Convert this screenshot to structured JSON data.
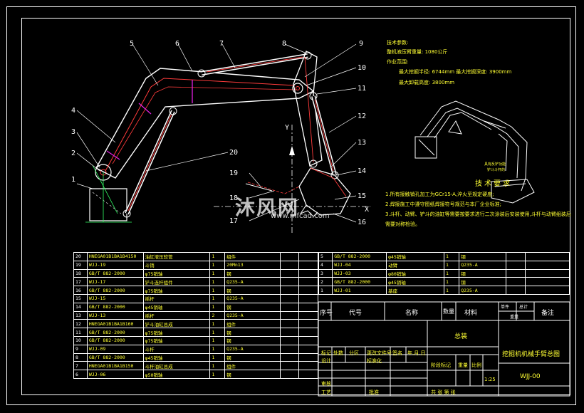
{
  "callouts": [
    "1",
    "2",
    "3",
    "4",
    "5",
    "6",
    "7",
    "8",
    "9",
    "10",
    "11",
    "12",
    "13",
    "14",
    "15",
    "16",
    "17",
    "18",
    "19",
    "20"
  ],
  "axis_label_y": "Y",
  "axis_label_x": "X",
  "tech_params": {
    "heading": "技术参数:",
    "line1": "整机液压臂重量: 1080公斤",
    "line2": "作业范围:",
    "line3": "最大挖掘半径: 6744mm    最大挖掘深度: 3900mm",
    "line4": "最大卸载高度: 3800mm"
  },
  "tech_req": {
    "title": "技术要求",
    "item1": "1.所有接触销孔加工为GCr15-A,淬火至规定硬度;",
    "item2": "2.焊接施工中遵守图纸焊接符号规范与本厂企业标准;",
    "item3": "3.斗杆、动臂、铲斗的油缸等需要按要求进行二次涂装后安装使用,斗杆与动臂组装后",
    "item4": "需要对称检验。"
  },
  "bom_left": [
    [
      "20",
      "HNEGA01B1BA1B4150",
      "油缸液压软管",
      "1",
      "组件",
      "",
      ""
    ],
    [
      "19",
      "WJJ-19",
      "斗销",
      "1",
      "20Mn13",
      "",
      ""
    ],
    [
      "18",
      "GB/T 882-2000",
      "φ75销轴",
      "1",
      "钢",
      "",
      ""
    ],
    [
      "17",
      "WJJ-17",
      "铲斗连杆组件",
      "1",
      "Q235-A",
      "",
      ""
    ],
    [
      "16",
      "GB/T 882-2000",
      "φ75销轴",
      "1",
      "钢",
      "",
      ""
    ],
    [
      "15",
      "WJJ-15",
      "摇杆",
      "1",
      "Q235-A",
      "",
      ""
    ],
    [
      "14",
      "GB/T 882-2000",
      "φ45销轴",
      "1",
      "钢",
      "",
      ""
    ],
    [
      "13",
      "WJJ-13",
      "摇杆",
      "2",
      "Q235-A",
      "",
      ""
    ],
    [
      "12",
      "HNEGA01B1BA1B160",
      "铲斗油缸总成",
      "1",
      "组件",
      "",
      ""
    ],
    [
      "11",
      "GB/T 882-2000",
      "φ75销轴",
      "1",
      "钢",
      "",
      ""
    ],
    [
      "10",
      "GB/T 882-2000",
      "φ75销轴",
      "1",
      "钢",
      "",
      ""
    ],
    [
      "9",
      "WJJ-09",
      "斗杆",
      "1",
      "Q235-A",
      "",
      ""
    ],
    [
      "8",
      "GB/T 882-2000",
      "φ45销轴",
      "1",
      "钢",
      "",
      ""
    ],
    [
      "7",
      "HNEGA01B1BA1B150",
      "斗杆油缸总成",
      "1",
      "组件",
      "",
      ""
    ],
    [
      "6",
      "WJJ-06",
      "φ50销轴",
      "1",
      "钢",
      "",
      ""
    ]
  ],
  "bom_right": [
    [
      "5",
      "GB/T 882-2000",
      "φ45销轴",
      "1",
      "钢",
      "",
      ""
    ],
    [
      "4",
      "WJJ-04",
      "动臂",
      "1",
      "Q235-A",
      "",
      ""
    ],
    [
      "3",
      "WJJ-03",
      "φ80销轴",
      "1",
      "钢",
      "",
      ""
    ],
    [
      "2",
      "GB/T 882-2000",
      "φ45销轴",
      "1",
      "钢",
      "",
      ""
    ],
    [
      "1",
      "WJJ-01",
      "基座",
      "1",
      "Q235-A",
      "",
      ""
    ]
  ],
  "header_row": {
    "seq": "序号",
    "code": "代号",
    "name": "名称",
    "qty": "数量",
    "material": "材料",
    "single": "单件",
    "total": "总计",
    "weight": "重量",
    "remark": "备注"
  },
  "title_block": {
    "assembly": "总装",
    "drawing_title": "挖掘机机械手臂总图",
    "drawing_no": "WJJ-00",
    "scale": "1:25",
    "mark": "标记",
    "count": "处数",
    "zone": "分区",
    "change_doc": "更改文件号",
    "sign": "签名",
    "date": "年.月.日",
    "design": "设计",
    "standardize": "标准化",
    "stage_mark": "阶段标记",
    "weight": "重量",
    "ratio": "比例",
    "review": "审核",
    "process": "工艺",
    "approve": "批准",
    "sheets": "共  张  第  张"
  },
  "watermark": {
    "brand": "沐风网",
    "url": "www.mfcad.com"
  }
}
